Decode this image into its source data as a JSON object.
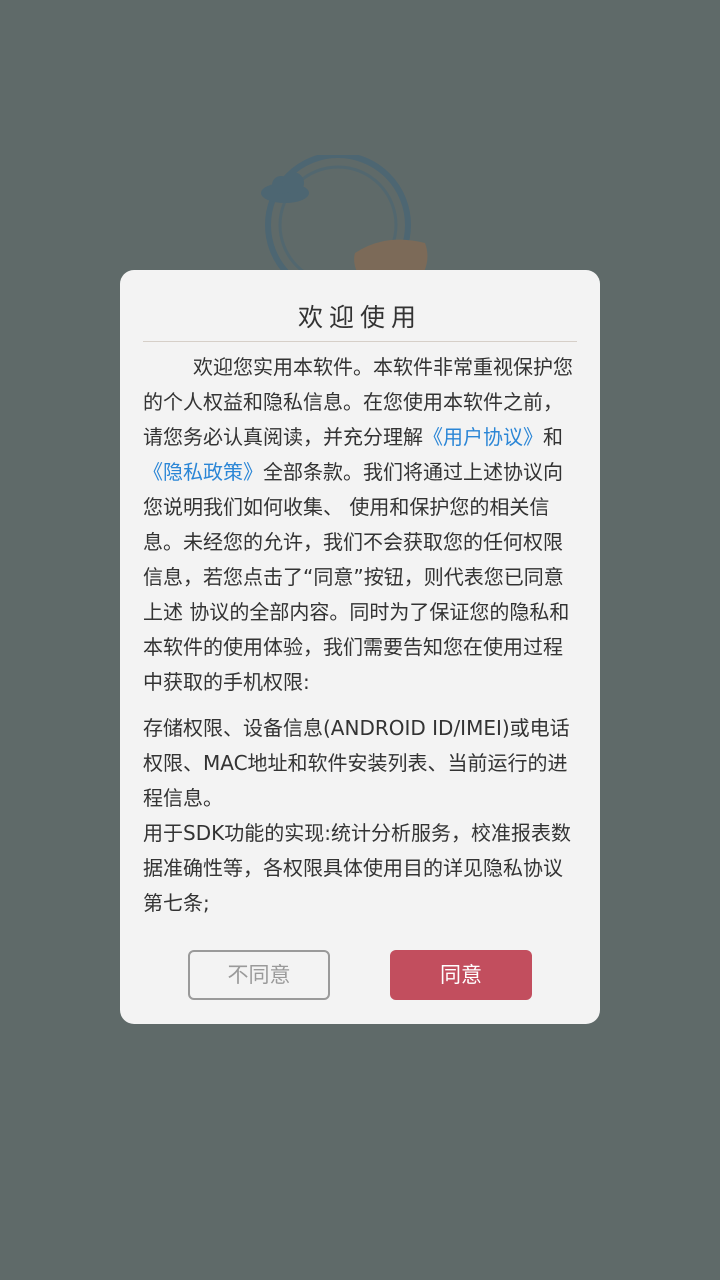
{
  "dialog": {
    "title": "欢迎使用",
    "intro_prefix": "欢迎您实用本软件。本软件非常重视保护您的个人权益和隐私信息。在您使用本软件之前，请您务必认真阅读，并充分理解",
    "user_agreement_link": "《用户协议》",
    "conjunction": "和",
    "privacy_policy_link": "《隐私政策》",
    "intro_suffix": "全部条款。我们将通过上述协议向您说明我们如何收集、 使用和保护您的相关信息。未经您的允许，我们不会获取您的任何权限信息，若您点击了“同意”按钮，则代表您已同意上述 协议的全部内容。同时为了保证您的隐私和本软件的使用体验，我们需要告知您在使用过程中获取的手机权限:",
    "permissions_text": "存储权限、设备信息(ANDROID ID/IMEI)或电话权限、MAC地址和软件安装列表、当前运行的进程信息。",
    "sdk_text": "用于SDK功能的实现:统计分析服务，校准报表数据准确性等，各权限具体使用目的详见隐私协议第七条;",
    "disagree_label": "不同意",
    "agree_label": "同意"
  },
  "colors": {
    "overlay_background": "#5f6a69",
    "dialog_background": "#f3f3f3",
    "link": "#2b86d6",
    "agree_button": "#c24e5e"
  },
  "icons": {
    "splash_logo": "circular-arrow-cloud-logo"
  }
}
